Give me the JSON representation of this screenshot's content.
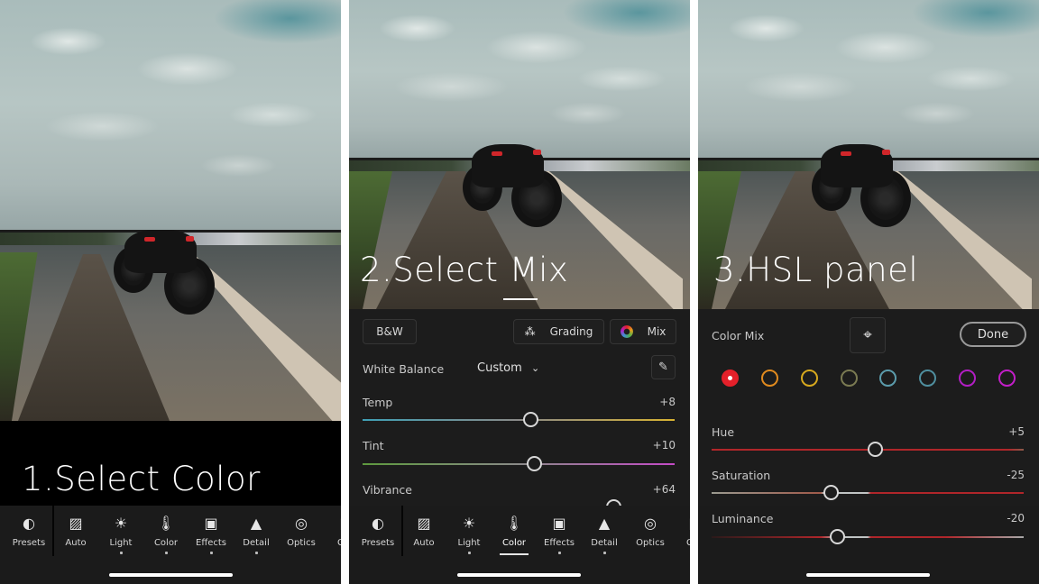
{
  "steps": [
    {
      "caption": "1.Select Color"
    },
    {
      "caption": "2.Select Mix"
    },
    {
      "caption": "3.HSL panel"
    }
  ],
  "toolbar": {
    "items": [
      {
        "label": "Presets",
        "icon": "presets-icon",
        "glyph": "◐"
      },
      {
        "label": "Auto",
        "icon": "auto-icon",
        "glyph": "▨"
      },
      {
        "label": "Light",
        "icon": "light-icon",
        "glyph": "☀"
      },
      {
        "label": "Color",
        "icon": "color-icon",
        "glyph": "🌡"
      },
      {
        "label": "Effects",
        "icon": "effects-icon",
        "glyph": "▣"
      },
      {
        "label": "Detail",
        "icon": "detail-icon",
        "glyph": "▲"
      },
      {
        "label": "Optics",
        "icon": "optics-icon",
        "glyph": "◎"
      },
      {
        "label": "Geo",
        "icon": "geometry-icon",
        "glyph": "▥"
      }
    ],
    "active_in_step2": "Color"
  },
  "color_panel": {
    "bw_label": "B&W",
    "grading_label": "Grading",
    "mix_label": "Mix",
    "white_balance_label": "White Balance",
    "white_balance_value": "Custom",
    "sliders": [
      {
        "name": "Temp",
        "value": "+8",
        "position": 0.54,
        "colors": [
          "#3f9fb4",
          "#d7b232"
        ]
      },
      {
        "name": "Tint",
        "value": "+10",
        "position": 0.55,
        "colors": [
          "#5e9a3e",
          "#c44bc7"
        ]
      },
      {
        "name": "Vibrance",
        "value": "+64",
        "position": 0.82,
        "colors": [
          "#777777",
          "#777777"
        ]
      }
    ]
  },
  "hsl_panel": {
    "title": "Color Mix",
    "done_label": "Done",
    "swatches": [
      {
        "name": "red",
        "color": "#e4202a",
        "selected": true
      },
      {
        "name": "orange",
        "color": "#e08a1e",
        "selected": false
      },
      {
        "name": "yellow",
        "color": "#d6a81e",
        "selected": false
      },
      {
        "name": "green",
        "color": "#7a7a52",
        "selected": false
      },
      {
        "name": "aqua",
        "color": "#5b9bab",
        "selected": false
      },
      {
        "name": "blue",
        "color": "#4f8e9e",
        "selected": false
      },
      {
        "name": "purple",
        "color": "#b21ec4",
        "selected": false
      },
      {
        "name": "magenta",
        "color": "#c21ec8",
        "selected": false
      }
    ],
    "sliders": [
      {
        "name": "Hue",
        "value": "+5",
        "position": 0.525
      },
      {
        "name": "Saturation",
        "value": "-25",
        "position": 0.38
      },
      {
        "name": "Luminance",
        "value": "-20",
        "position": 0.4
      }
    ]
  }
}
